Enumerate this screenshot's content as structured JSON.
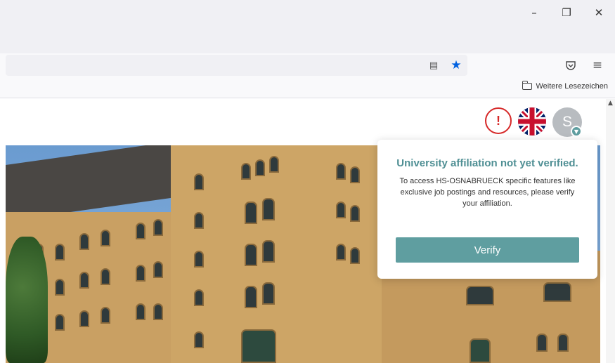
{
  "window": {
    "minimize_icon": "minimize-icon",
    "restore_icon": "restore-icon",
    "close_icon": "close-icon"
  },
  "toolbar": {
    "reader_icon": "reader-view-icon",
    "star_icon": "bookmark-star-icon",
    "pocket_icon": "pocket-icon",
    "menu_icon": "hamburger-menu-icon"
  },
  "bookmarks": {
    "other_bookmarks": "Weitere Lesezeichen"
  },
  "header": {
    "avatar_initial": "S"
  },
  "popup": {
    "title": "University affiliation not yet verified.",
    "body": "To access HS-OSNABRUECK specific features like exclusive job postings and resources, please verify your affiliation.",
    "button_label": "Verify"
  },
  "colors": {
    "accent": "#5f9ea0",
    "alert": "#d62828",
    "bookmark_star": "#0061e0"
  }
}
